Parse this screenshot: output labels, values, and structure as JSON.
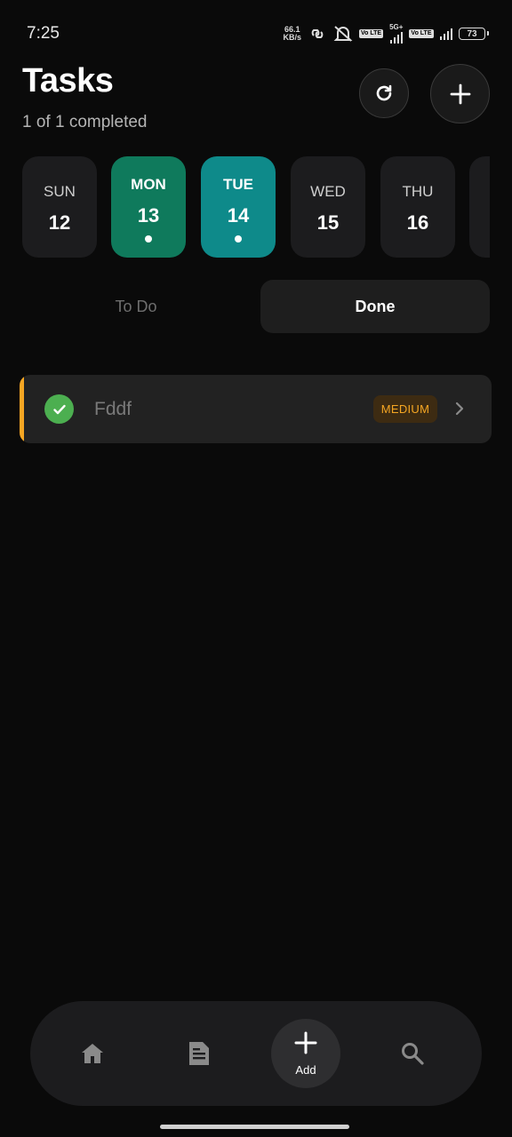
{
  "status_bar": {
    "time": "7:25",
    "speed_value": "66.1",
    "speed_unit": "KB/s",
    "volte1": "Vo LTE",
    "network": "5G+",
    "volte2": "Vo LTE",
    "battery": "73"
  },
  "header": {
    "title": "Tasks",
    "subtitle": "1 of 1 completed",
    "refresh_icon": "refresh-icon",
    "add_icon": "plus-icon"
  },
  "calendar": {
    "days": [
      {
        "name": "SUN",
        "num": "12"
      },
      {
        "name": "MON",
        "num": "13"
      },
      {
        "name": "TUE",
        "num": "14"
      },
      {
        "name": "WED",
        "num": "15"
      },
      {
        "name": "THU",
        "num": "16"
      }
    ],
    "colors": {
      "mon": "#0f7a5c",
      "tue": "#0e8a8a"
    }
  },
  "tabs": {
    "todo": "To Do",
    "done": "Done",
    "active": "done"
  },
  "tasks": [
    {
      "title": "Fddf",
      "priority": "MEDIUM",
      "completed": true,
      "accent": "#f5a623"
    }
  ],
  "bottom_nav": {
    "home_icon": "home-icon",
    "notes_icon": "notes-icon",
    "add_label": "Add",
    "search_icon": "search-icon"
  }
}
